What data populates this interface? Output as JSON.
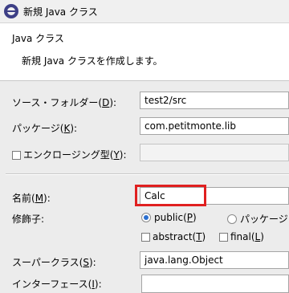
{
  "window": {
    "title": "新規 Java クラス",
    "icon": "eclipse-icon"
  },
  "header": {
    "title": "Java クラス",
    "description": "新規 Java クラスを作成します。"
  },
  "source_folder": {
    "label": "ソース・フォルダー(",
    "mnemonic": "D",
    "suffix": "):",
    "value": "test2/src"
  },
  "package": {
    "label": "パッケージ(",
    "mnemonic": "K",
    "suffix": "):",
    "value": "com.petitmonte.lib"
  },
  "enclosing": {
    "label": "エンクロージング型(",
    "mnemonic": "Y",
    "suffix": "):",
    "checked": false,
    "value": ""
  },
  "name": {
    "label": "名前(",
    "mnemonic": "M",
    "suffix": "):",
    "value": "Calc"
  },
  "modifiers": {
    "label": "修飾子:",
    "public": {
      "label": "public(",
      "mnemonic": "P",
      "suffix": ")",
      "selected": true
    },
    "package": {
      "label": "パッケージ",
      "selected": false
    },
    "abstract": {
      "label": "abstract(",
      "mnemonic": "T",
      "suffix": ")",
      "checked": false
    },
    "final": {
      "label": "final(",
      "mnemonic": "L",
      "suffix": ")",
      "checked": false
    }
  },
  "superclass": {
    "label": "スーパークラス(",
    "mnemonic": "S",
    "suffix": "):",
    "value": "java.lang.Object"
  },
  "interfaces": {
    "label": "インターフェース(",
    "mnemonic": "I",
    "suffix": "):"
  },
  "colors": {
    "highlight": "#e02020",
    "radio_selected": "#2a6fd0"
  }
}
